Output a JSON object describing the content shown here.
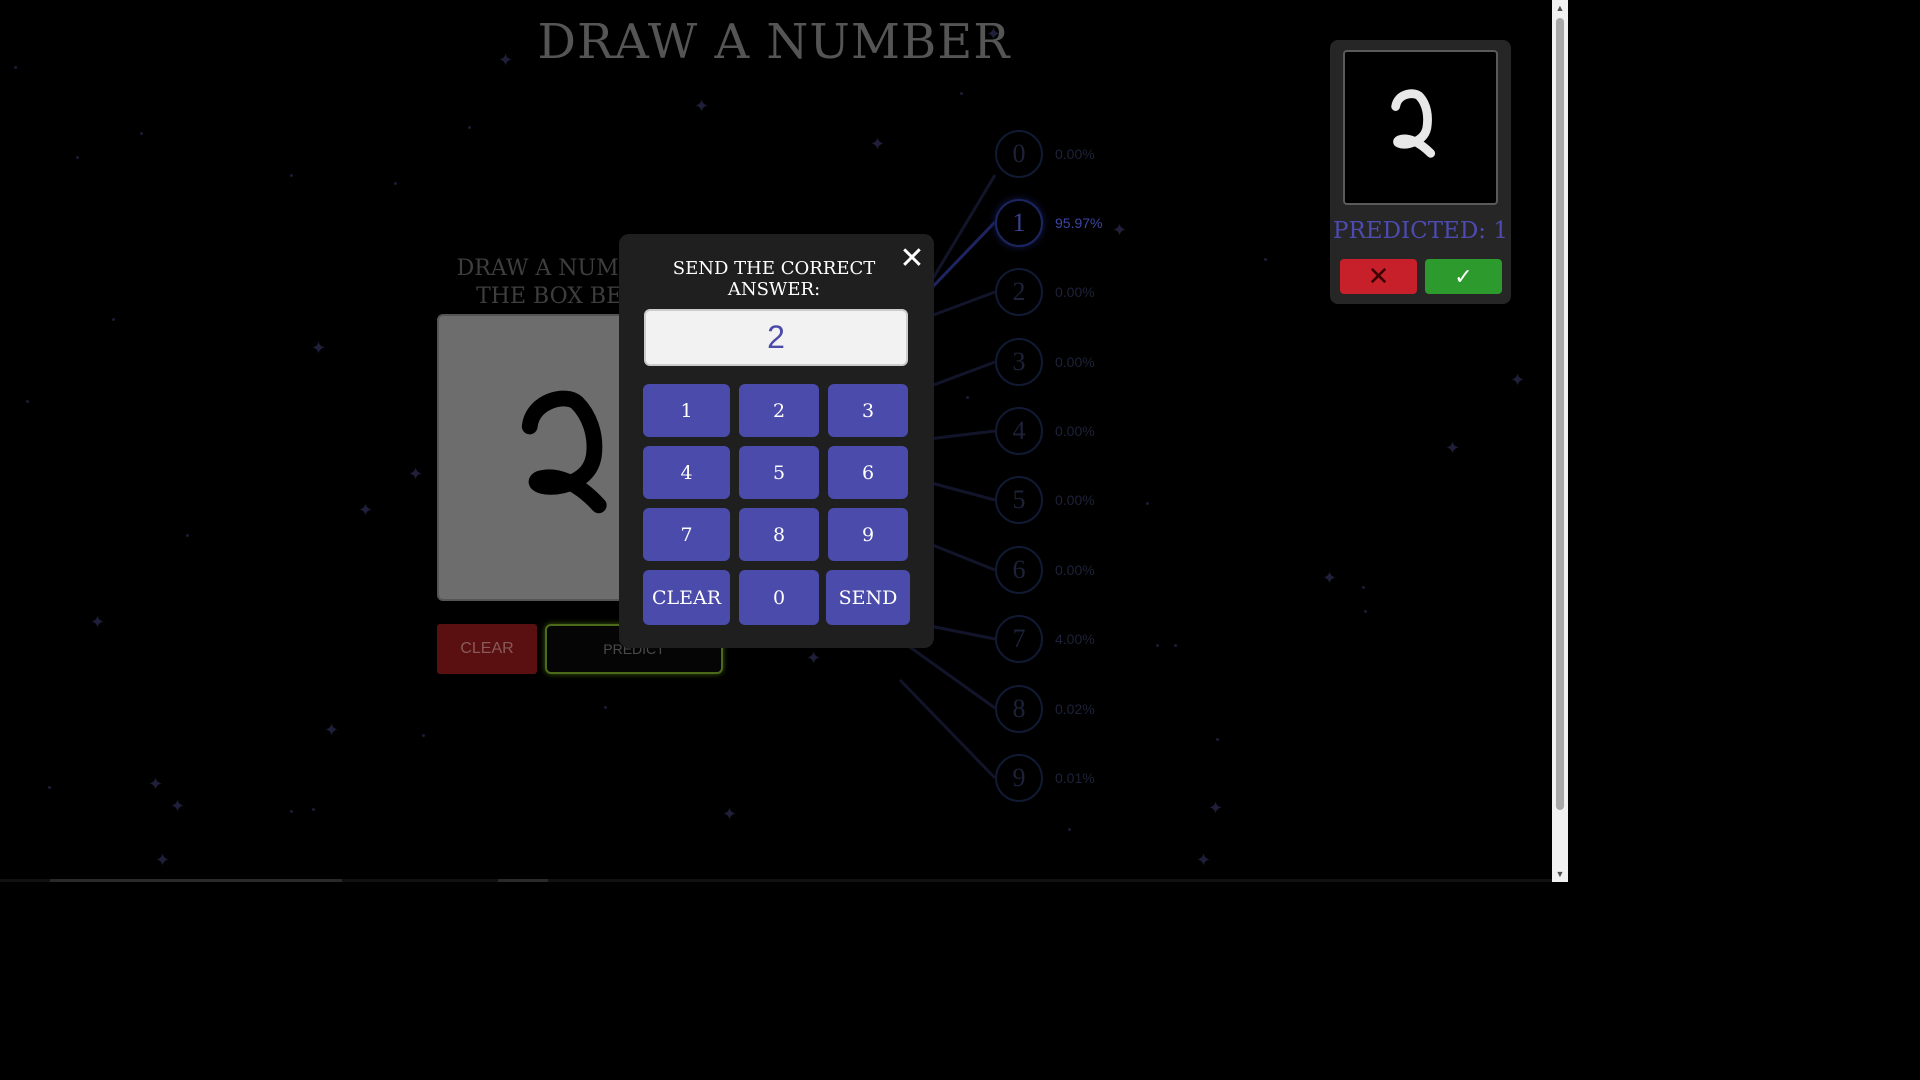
{
  "page": {
    "title": "DRAW A NUMBER",
    "draw_label": "DRAW A NUMBER IN THE BOX BELOW:",
    "clear_label": "CLEAR",
    "predict_label": "PREDICT"
  },
  "network": {
    "outputs": [
      {
        "digit": "0",
        "percent": "0.00%"
      },
      {
        "digit": "1",
        "percent": "95.97%"
      },
      {
        "digit": "2",
        "percent": "0.00%"
      },
      {
        "digit": "3",
        "percent": "0.00%"
      },
      {
        "digit": "4",
        "percent": "0.00%"
      },
      {
        "digit": "5",
        "percent": "0.00%"
      },
      {
        "digit": "6",
        "percent": "0.00%"
      },
      {
        "digit": "7",
        "percent": "4.00%"
      },
      {
        "digit": "8",
        "percent": "0.02%"
      },
      {
        "digit": "9",
        "percent": "0.01%"
      }
    ],
    "active_digit": "1"
  },
  "prediction_card": {
    "label": "PREDICTED: 1",
    "wrong_icon": "close-icon",
    "right_icon": "check-icon",
    "wrong_glyph": "✕",
    "right_glyph": "✓"
  },
  "modal": {
    "title": "SEND THE CORRECT ANSWER:",
    "close_glyph": "✕",
    "answer_value": "2",
    "keys": {
      "k1": "1",
      "k2": "2",
      "k3": "3",
      "k4": "4",
      "k5": "5",
      "k6": "6",
      "k7": "7",
      "k8": "8",
      "k9": "9",
      "clear": "CLEAR",
      "k0": "0",
      "send": "SEND"
    }
  },
  "colors": {
    "accent": "#4b4bab",
    "wrong": "#c8202a",
    "right": "#2c9a2c",
    "modal_bg": "#1f1f1f"
  }
}
